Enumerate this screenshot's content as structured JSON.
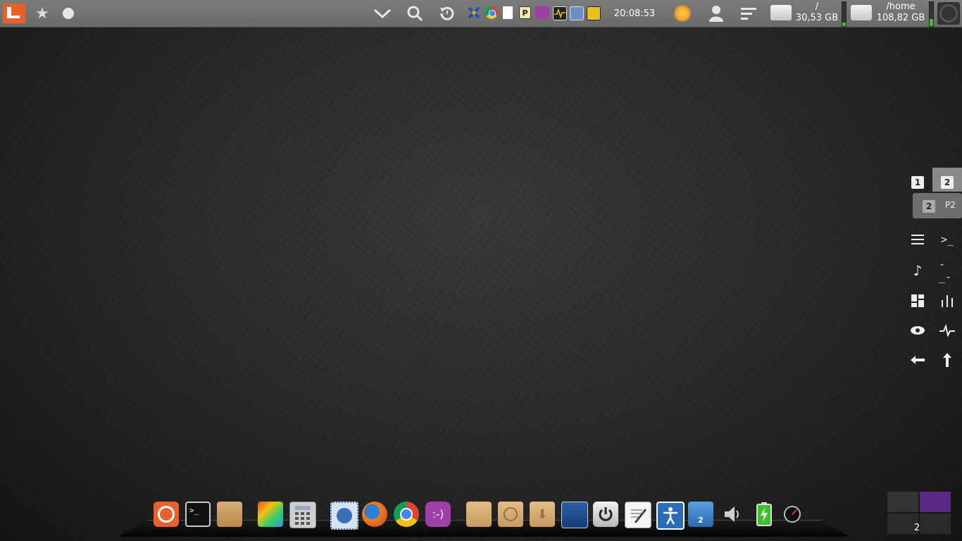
{
  "top_panel": {
    "clock": "20:08:53",
    "disks": [
      {
        "mount": "/",
        "free": "30,53 GB",
        "fill_fraction": 0.15
      },
      {
        "mount": "/home",
        "free": "108,82 GB",
        "fill_fraction": 0.3
      }
    ],
    "icons": [
      "ubuntu-menu-icon",
      "star-icon",
      "circle-icon",
      "chevron-down-icon",
      "search-icon",
      "history-icon"
    ],
    "tray": [
      "xchat-icon",
      "chrome-icon",
      "document-icon",
      "pidgin-icon",
      "empathy-icon",
      "system-monitor-icon",
      "thunderbird-icon",
      "note-icon"
    ],
    "indicators": [
      "weather-icon",
      "user-icon",
      "menu-lines-icon"
    ]
  },
  "workspace_widget": {
    "workspace_labels": [
      "1",
      "2"
    ],
    "preview_label": "2",
    "preview_tag": "P2"
  },
  "pager": {
    "current_label": "2"
  },
  "dock": {
    "items": [
      "ubuntu-icon",
      "terminal-icon",
      "archive-manager-icon",
      "paint-icon",
      "calculator-icon",
      "thunderbird-icon",
      "firefox-icon",
      "chromium-icon",
      "empathy-icon",
      "documents-folder-icon",
      "recent-folder-icon",
      "downloads-folder-icon",
      "screenshot-icon",
      "power-icon",
      "text-editor-icon",
      "accessibility-icon",
      "recycle-bin-icon",
      "volume-icon",
      "battery-icon",
      "speedometer-icon"
    ],
    "recycle_badge": "2"
  },
  "colors": {
    "accent": "#e8602c",
    "panel": "#707070",
    "disk_fill": "#3fbf2f",
    "pager_active": "#5b2a86"
  }
}
